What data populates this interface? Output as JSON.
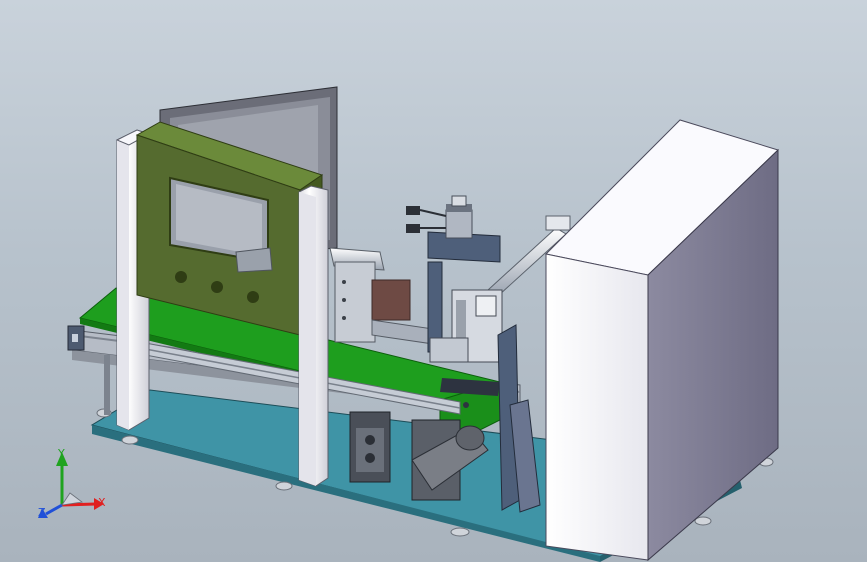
{
  "triad": {
    "x_label": "X",
    "y_label": "Y",
    "z_label": "Z",
    "x_color": "#e02020",
    "y_color": "#1fa31f",
    "z_color": "#2050d8"
  },
  "colors": {
    "background_top": "#c9d2db",
    "baseplate": "#3f94a6",
    "belt": "#1e9e1e",
    "hood": "#556b2f",
    "column": "#f2f2f5",
    "cabinet": "#f4f4f8",
    "metal": "#a9b0bb",
    "bracket": "#4e5f7a",
    "motor": "#6b6b6b"
  }
}
